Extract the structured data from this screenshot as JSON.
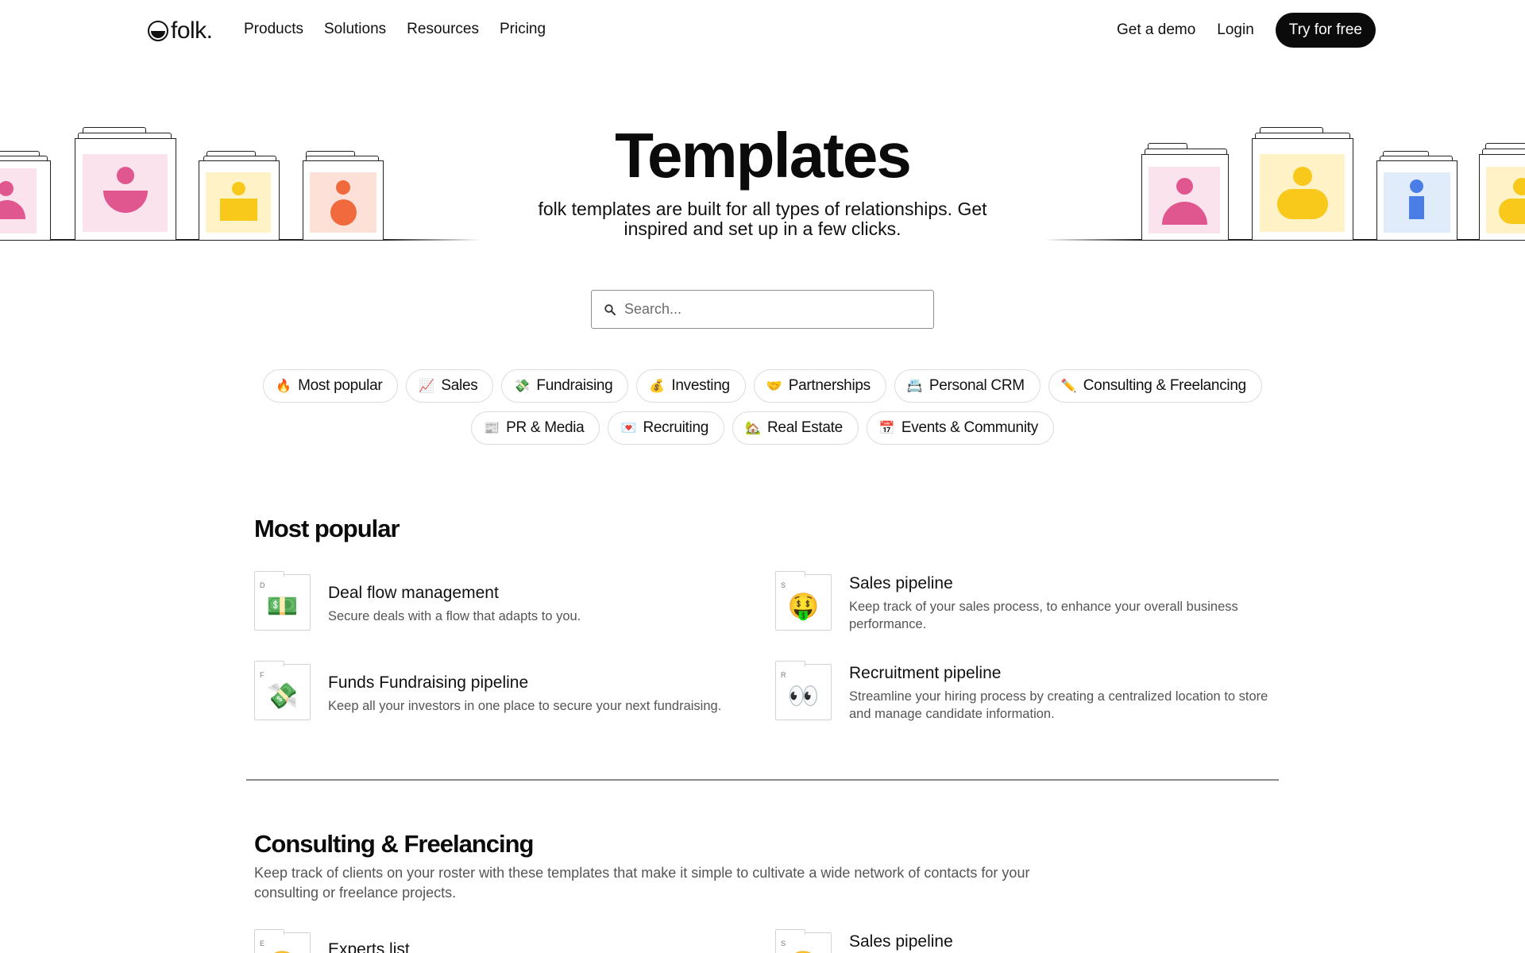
{
  "nav": {
    "logo": "folk.",
    "links": [
      "Products",
      "Solutions",
      "Resources",
      "Pricing"
    ],
    "demo": "Get a demo",
    "login": "Login",
    "cta": "Try for free"
  },
  "hero": {
    "title": "Templates",
    "subtitle": "folk templates are built for all types of relationships. Get inspired and set up in a few clicks."
  },
  "search": {
    "placeholder": "Search..."
  },
  "filters": {
    "row1": [
      {
        "icon": "🔥",
        "label": "Most popular"
      },
      {
        "icon": "📈",
        "label": "Sales"
      },
      {
        "icon": "💸",
        "label": "Fundraising"
      },
      {
        "icon": "💰",
        "label": "Investing"
      },
      {
        "icon": "🤝",
        "label": "Partnerships"
      },
      {
        "icon": "📇",
        "label": "Personal CRM"
      },
      {
        "icon": "✏️",
        "label": "Consulting & Freelancing"
      }
    ],
    "row2": [
      {
        "icon": "📰",
        "label": "PR & Media"
      },
      {
        "icon": "💌",
        "label": "Recruiting"
      },
      {
        "icon": "🏡",
        "label": "Real Estate"
      },
      {
        "icon": "📅",
        "label": "Events & Community"
      }
    ]
  },
  "most_popular": {
    "title": "Most popular",
    "cards": [
      {
        "letter": "D",
        "emoji": "💵",
        "title": "Deal flow management",
        "desc": "Secure deals with a flow that adapts to you."
      },
      {
        "letter": "S",
        "emoji": "🤑",
        "title": "Sales pipeline",
        "desc": "Keep track of your sales process, to enhance your overall business performance."
      },
      {
        "letter": "F",
        "emoji": "💸",
        "title": "Funds Fundraising pipeline",
        "desc": "Keep all your investors in one place to secure your next fundraising."
      },
      {
        "letter": "R",
        "emoji": "👀",
        "title": "Recruitment pipeline",
        "desc": "Streamline your hiring process by creating a centralized location to store and manage candidate information."
      }
    ]
  },
  "consulting": {
    "title": "Consulting & Freelancing",
    "desc": "Keep track of clients on your roster with these templates that make it simple to cultivate a wide network of contacts for your consulting or freelance projects.",
    "cards": [
      {
        "letter": "E",
        "emoji": "😊",
        "title": "Experts list"
      },
      {
        "letter": "S",
        "emoji": "😊",
        "title": "Sales pipeline"
      }
    ]
  },
  "colors": {
    "pink_bg": "#fbe3ee",
    "pink": "#e0568f",
    "yellow_bg": "#fff2c6",
    "yellow": "#f8c81a",
    "orange_bg": "#fde1d8",
    "orange": "#f06a3e",
    "blue_bg": "#e1ecfb",
    "blue": "#4b7de6"
  }
}
